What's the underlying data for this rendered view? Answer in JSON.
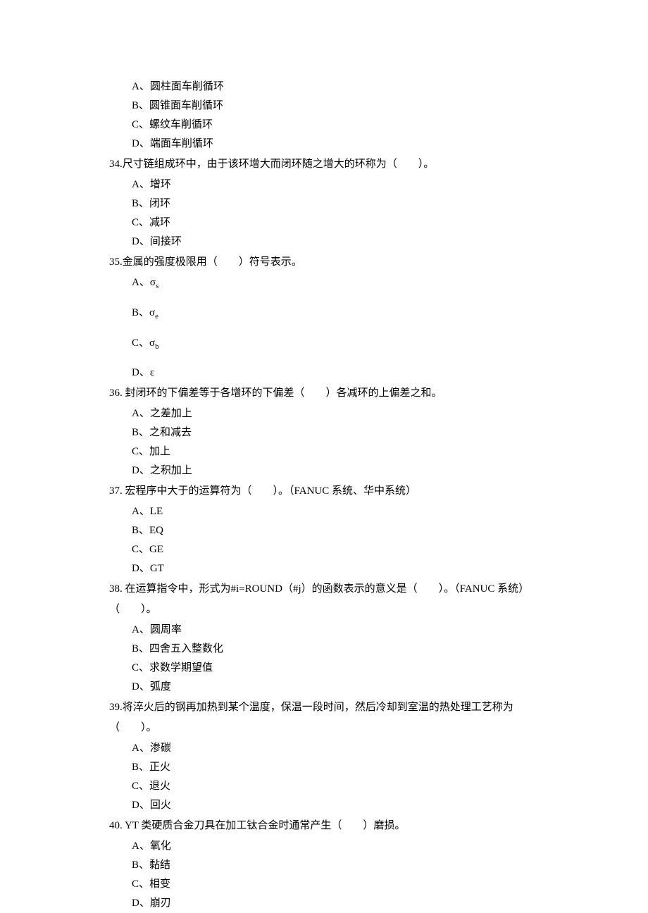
{
  "q33": {
    "options": {
      "a": "A、圆柱面车削循环",
      "b": "B、圆锥面车削循环",
      "c": "C、螺纹车削循环",
      "d": "D、端面车削循环"
    }
  },
  "q34": {
    "text": "34.尺寸链组成环中，由于该环增大而闭环随之增大的环称为（　　）。",
    "options": {
      "a": "A、增环",
      "b": "B、闭环",
      "c": "C、减环",
      "d": "D、间接环"
    }
  },
  "q35": {
    "text": "35.金属的强度极限用（　　）符号表示。",
    "options": {
      "a_prefix": "A、",
      "a_sym": "σ",
      "a_sub": "s",
      "b_prefix": "B、",
      "b_sym": "σ",
      "b_sub": "e",
      "c_prefix": "C、",
      "c_sym": "σ",
      "c_sub": "b",
      "d": "D、ε"
    }
  },
  "q36": {
    "text": "36. 封闭环的下偏差等于各增环的下偏差（　　）各减环的上偏差之和。",
    "options": {
      "a": "A、之差加上",
      "b": "B、之和减去",
      "c": "C、加上",
      "d": "D、之积加上"
    }
  },
  "q37": {
    "text": "37. 宏程序中大于的运算符为（　　）。（FANUC 系统、华中系统）",
    "options": {
      "a": "A、LE",
      "b": "B、EQ",
      "c": "C、GE",
      "d": "D、GT"
    }
  },
  "q38": {
    "text": "38. 在运算指令中，形式为#i=ROUND（#j）的函数表示的意义是（　　）。（FANUC 系统）",
    "cont": "（　　）。",
    "options": {
      "a": "A、圆周率",
      "b": "B、四舍五入整数化",
      "c": "C、求数学期望值",
      "d": "D、弧度"
    }
  },
  "q39": {
    "text": "39.将淬火后的钢再加热到某个温度，保温一段时间，然后冷却到室温的热处理工艺称为",
    "cont": "（　　）。",
    "options": {
      "a": "A、渗碳",
      "b": "B、正火",
      "c": "C、退火",
      "d": "D、回火"
    }
  },
  "q40": {
    "text": "40. YT 类硬质合金刀具在加工钛合金时通常产生（　　）磨损。",
    "options": {
      "a": "A、氧化",
      "b": "B、黏结",
      "c": "C、相变",
      "d": "D、崩刃"
    }
  }
}
